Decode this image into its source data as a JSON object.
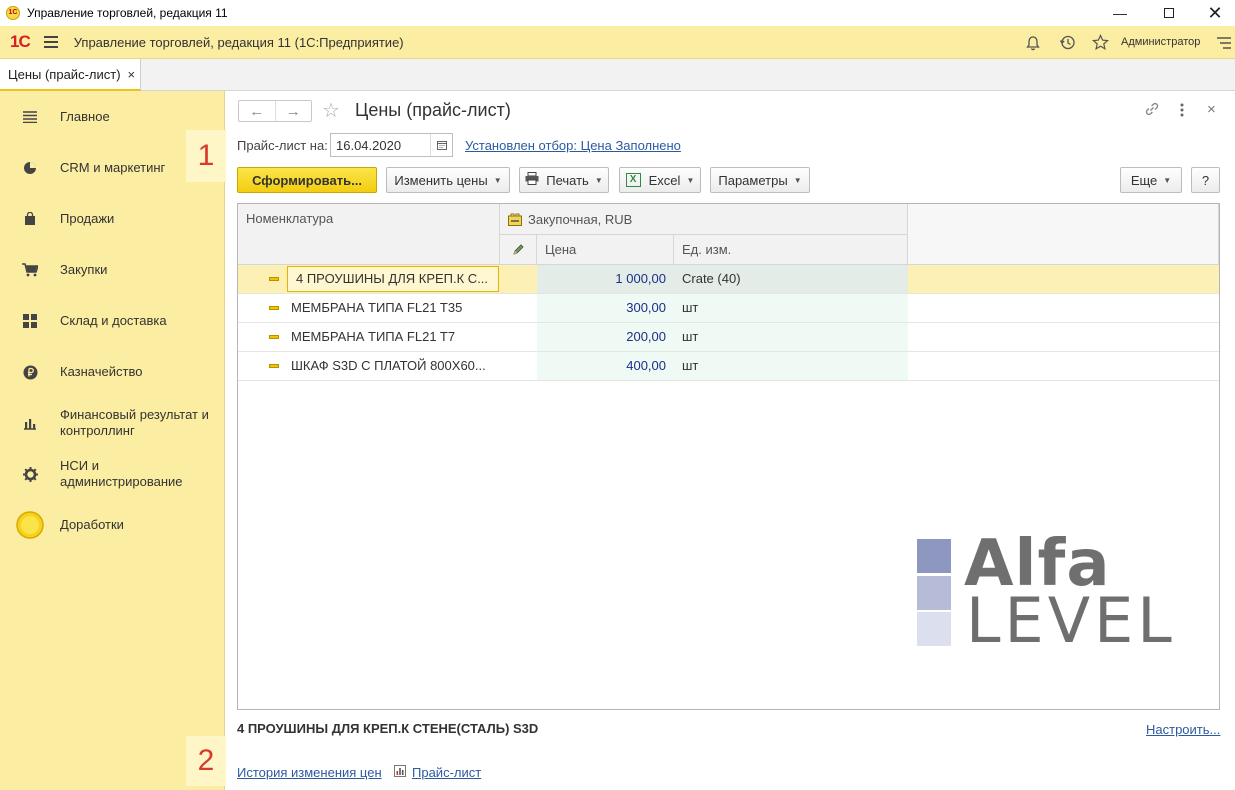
{
  "window": {
    "title": "Управление торговлей, редакция 11",
    "logo_small": "1С"
  },
  "app_toolbar": {
    "logo": "1С",
    "title": "Управление торговлей, редакция 11  (1С:Предприятие)",
    "user": "Администратор"
  },
  "tab": {
    "label": "Цены (прайс-лист)",
    "close": "×"
  },
  "sidebar": {
    "items": [
      {
        "label": "Главное",
        "icon": "menu-icon"
      },
      {
        "label": "CRM и маркетинг",
        "icon": "pie-chart-icon"
      },
      {
        "label": "Продажи",
        "icon": "shopping-bag-icon"
      },
      {
        "label": "Закупки",
        "icon": "cart-icon"
      },
      {
        "label": "Склад и доставка",
        "icon": "warehouse-icon"
      },
      {
        "label": "Казначейство",
        "icon": "ruble-icon"
      },
      {
        "label": "Финансовый результат и контроллинг",
        "icon": "bar-chart-icon"
      },
      {
        "label": "НСИ и администрирование",
        "icon": "gear-icon"
      },
      {
        "label": "Доработки",
        "icon": "yellow-circle-icon"
      }
    ],
    "marker_1": "1",
    "marker_2": "2"
  },
  "form": {
    "title": "Цены (прайс-лист)",
    "date_label": "Прайс-лист на:",
    "date_value": "16.04.2020",
    "filter_link": "Установлен отбор: Цена Заполнено",
    "buttons": {
      "generate": "Сформировать...",
      "change_prices": "Изменить цены",
      "print": "Печать",
      "excel": "Excel",
      "params": "Параметры",
      "more": "Еще",
      "help": "?"
    },
    "table": {
      "col_name": "Номенклатура",
      "col_group": "Закупочная, RUB",
      "col_price": "Цена",
      "col_unit": "Ед. изм.",
      "rows": [
        {
          "name": "4 ПРОУШИНЫ ДЛЯ КРЕП.К С...",
          "price": "1 000,00",
          "unit": "Crate (40)"
        },
        {
          "name": "МЕМБРАНА ТИПА FL21 T35",
          "price": "300,00",
          "unit": "шт"
        },
        {
          "name": "МЕМБРАНА ТИПА FL21 T7",
          "price": "200,00",
          "unit": "шт"
        },
        {
          "name": "ШКАФ S3D С ПЛАТОЙ 800Х60...",
          "price": "400,00",
          "unit": "шт"
        }
      ]
    },
    "detail": "4 ПРОУШИНЫ ДЛЯ КРЕП.К СТЕНЕ(СТАЛЬ) S3D",
    "configure_link": "Настроить...",
    "history_link": "История изменения цен",
    "pricelist_link": "Прайс-лист"
  },
  "watermark": {
    "line1": "Alfa",
    "line2": "LEVEL",
    "colors": [
      "#8e97c0",
      "#b6bbd8",
      "#dcdfee"
    ]
  },
  "colors": {
    "accent_yellow": "#fbeda1",
    "button_yellow": "#f3cd10",
    "link_blue": "#2c5aa0",
    "price_blue": "#1c2e8a"
  }
}
